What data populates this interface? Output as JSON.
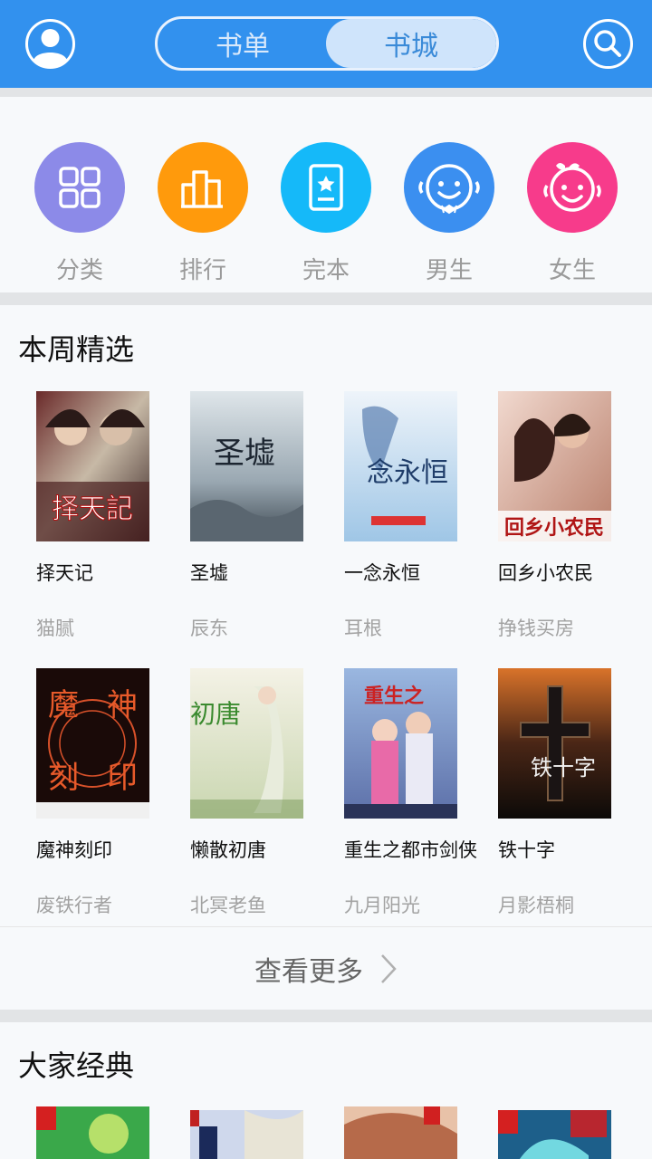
{
  "header": {
    "tabs": [
      {
        "label": "书单",
        "active": false
      },
      {
        "label": "书城",
        "active": true
      }
    ],
    "brand_color": "#3291ee"
  },
  "categories": [
    {
      "label": "分类",
      "icon": "grid-icon",
      "color": "#8c8ae8"
    },
    {
      "label": "排行",
      "icon": "bar-chart-icon",
      "color": "#ff9a0c"
    },
    {
      "label": "完本",
      "icon": "book-star-icon",
      "color": "#15b9f9"
    },
    {
      "label": "男生",
      "icon": "boy-face-icon",
      "color": "#3b8ff0"
    },
    {
      "label": "女生",
      "icon": "girl-face-icon",
      "color": "#f73b8b"
    }
  ],
  "weekly": {
    "title": "本周精选",
    "books": [
      {
        "title": "择天记",
        "author": "猫腻"
      },
      {
        "title": "圣墟",
        "author": "辰东"
      },
      {
        "title": "一念永恒",
        "author": "耳根"
      },
      {
        "title": "回乡小农民",
        "author": "挣钱买房"
      },
      {
        "title": "魔神刻印",
        "author": "废铁行者"
      },
      {
        "title": "懒散初唐",
        "author": "北冥老鱼"
      },
      {
        "title": "重生之都市剑侠",
        "author": "九月阳光"
      },
      {
        "title": "铁十字",
        "author": "月影梧桐"
      }
    ],
    "more_label": "查看更多"
  },
  "classics": {
    "title": "大家经典"
  }
}
